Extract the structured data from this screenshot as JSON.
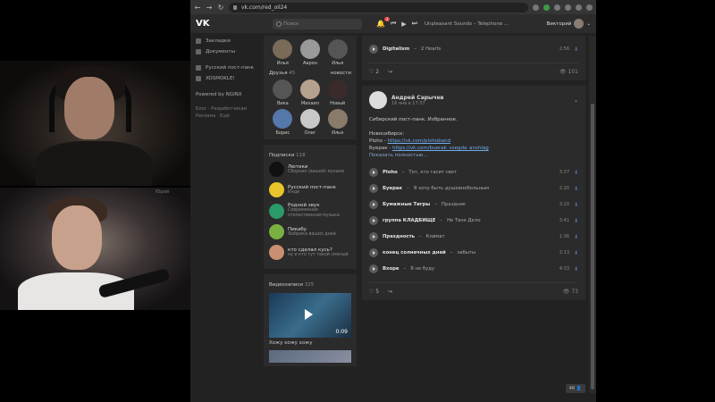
{
  "browser": {
    "url": "vk.com/red_oil24",
    "tab_title": ""
  },
  "header": {
    "logo": "VK",
    "search_placeholder": "Поиск",
    "notif_count": "3",
    "track": "Unpleasant Sounds – Telephone ...",
    "user": "Викторий"
  },
  "leftnav": {
    "items": [
      {
        "label": "Закладки"
      },
      {
        "label": "Документы"
      },
      {
        "label": "Русский пост-панк"
      },
      {
        "label": "XOSMOKLE!"
      }
    ],
    "powered": "Powered by NGINX",
    "footer": [
      "Блог",
      "Разработчикам",
      "Реклама",
      "Ещё"
    ]
  },
  "friends_top": [
    {
      "name": "Илья",
      "color": "#7a6a58"
    },
    {
      "name": "Аарон",
      "color": "#9a9a9a"
    },
    {
      "name": "Илья",
      "color": "#555"
    }
  ],
  "friends": {
    "title": "Друзья",
    "count": "45",
    "news": "новости",
    "items": [
      {
        "name": "Вика",
        "color": "#555"
      },
      {
        "name": "Михаил",
        "color": "#b5a28e"
      },
      {
        "name": "Новый",
        "color": "#3a2a2a"
      },
      {
        "name": "Борис",
        "color": "#5577aa"
      },
      {
        "name": "Олег",
        "color": "#c8c8c8"
      },
      {
        "name": "Илья",
        "color": "#8a7a6a"
      }
    ]
  },
  "subs": {
    "title": "Подписки",
    "count": "118",
    "items": [
      {
        "name": "Лютики",
        "desc": "Сборник (вашей) музыки",
        "color": "#111"
      },
      {
        "name": "Русский пост-панк",
        "desc": "Инди",
        "color": "#e8c52a"
      },
      {
        "name": "Родной звук",
        "desc": "Современная отечественная музыка",
        "color": "#2a9a6a"
      },
      {
        "name": "Пикабу",
        "desc": "Фабрика ваших дней",
        "color": "#7ab040"
      },
      {
        "name": "кто сделал кусь?",
        "desc": "ну и кто тут такой смелый",
        "color": "#c89070"
      }
    ]
  },
  "videos": {
    "title": "Видеозаписи",
    "count": "325",
    "duration": "0:09",
    "caption": "Хожу хожу хожу"
  },
  "post1": {
    "track": {
      "artist": "Digitalism",
      "title": "2 Hearts",
      "dur": "2:56"
    },
    "likes": "2",
    "views": "101"
  },
  "post2": {
    "author": "Андрей Сарычев",
    "date": "16 янв в 17:37",
    "text1": "Сибирский пост-панк. Избранное.",
    "text2": "Новосибирск:",
    "ploho_label": "Ploho - ",
    "ploho_link": "https://vk.com/plohoband",
    "buerak_label": "Буерак - ",
    "buerak_link": "https://vk.com/buerak_vsegda_anshlag",
    "more": "Показать полностью...",
    "tracks": [
      {
        "artist": "Ploho",
        "title": "Тот, кто гасит свет",
        "dur": "3:37"
      },
      {
        "artist": "Буерак",
        "title": "Я хочу быть душевнобольным",
        "dur": "2:20"
      },
      {
        "artist": "Бумажные Тигры",
        "title": "Праздник",
        "dur": "3:20"
      },
      {
        "artist": "группа КЛАДБИЩЕ",
        "title": "Не Твое Дело",
        "dur": "3:41"
      },
      {
        "artist": "Праздность",
        "title": "Климат",
        "dur": "1:36"
      },
      {
        "artist": "конец солнечных дней",
        "title": "забыты",
        "dur": "2:13"
      },
      {
        "artist": "Вхоре",
        "title": "Я не буду",
        "dur": "4:33"
      }
    ],
    "likes": "5",
    "views": "73"
  },
  "bottom": {
    "badge": "46"
  },
  "side_label": "Юрий"
}
